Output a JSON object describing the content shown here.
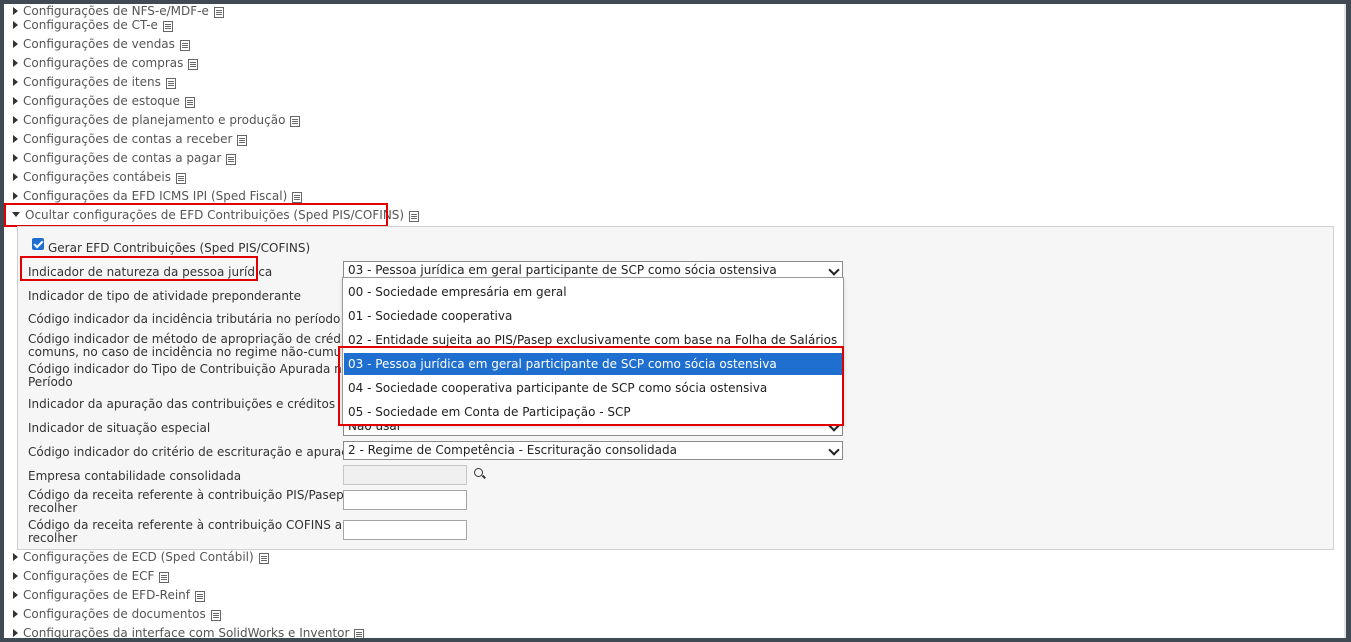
{
  "sections_top": [
    {
      "label": "Configurações de NFS-e/MDF-e"
    },
    {
      "label": "Configurações de CT-e"
    },
    {
      "label": "Configurações de vendas"
    },
    {
      "label": "Configurações de compras"
    },
    {
      "label": "Configurações de itens"
    },
    {
      "label": "Configurações de estoque"
    },
    {
      "label": "Configurações de planejamento e produção"
    },
    {
      "label": "Configurações de contas a receber"
    },
    {
      "label": "Configurações de contas a pagar"
    },
    {
      "label": "Configurações contábeis"
    },
    {
      "label": "Configurações da EFD ICMS IPI (Sped Fiscal)"
    }
  ],
  "expanded_section": {
    "label": "Ocultar configurações de EFD Contribuições (Sped PIS/COFINS)"
  },
  "form": {
    "gerar_checkbox_label": "Gerar EFD Contribuições (Sped PIS/COFINS)",
    "fields": [
      {
        "label": "Indicador de natureza da pessoa jurídica",
        "value": "03 - Pessoa jurídica em geral participante de SCP como sócia ostensiva"
      },
      {
        "label": "Indicador de tipo de atividade preponderante"
      },
      {
        "label": "Código indicador da incidência tributária no período"
      },
      {
        "label_line1": "Código indicador de método de apropriação de créditos",
        "label_line2": "comuns, no caso de incidência no regime não-cumulativo"
      },
      {
        "label_line1": "Código indicador do Tipo de Contribuição Apurada no",
        "label_line2": "Período"
      },
      {
        "label": "Indicador da apuração das contribuições e créditos"
      },
      {
        "label": "Indicador de situação especial",
        "value": "Não usar"
      },
      {
        "label": "Código indicador do critério de escrituração e apuração",
        "value": "2 - Regime de Competência - Escrituração consolidada"
      },
      {
        "label": "Empresa contabilidade consolidada",
        "value": ""
      },
      {
        "label_line1": "Código da receita referente à contribuição PIS/Pasep a",
        "label_line2": "recolher",
        "value": ""
      },
      {
        "label_line1": "Código da receita referente à contribuição COFINS a",
        "label_line2": "recolher",
        "value": ""
      }
    ]
  },
  "dropdown_options": [
    {
      "label": "00 - Sociedade empresária em geral"
    },
    {
      "label": "01 - Sociedade cooperativa"
    },
    {
      "label": "02 - Entidade sujeita ao PIS/Pasep exclusivamente com base na Folha de Salários"
    },
    {
      "label": "03 - Pessoa jurídica em geral participante de SCP como sócia ostensiva"
    },
    {
      "label": "04 - Sociedade cooperativa participante de SCP como sócia ostensiva"
    },
    {
      "label": "05 - Sociedade em Conta de Participação - SCP"
    }
  ],
  "selected_option_index": 3,
  "sections_bottom": [
    {
      "label": "Configurações de ECD (Sped Contábil)"
    },
    {
      "label": "Configurações de ECF"
    },
    {
      "label": "Configurações de EFD-Reinf"
    },
    {
      "label": "Configurações de documentos"
    },
    {
      "label": "Configurações da interface com SolidWorks e Inventor"
    }
  ],
  "colors": {
    "highlight": "#1e6fd0",
    "annotation": "#e00000"
  }
}
